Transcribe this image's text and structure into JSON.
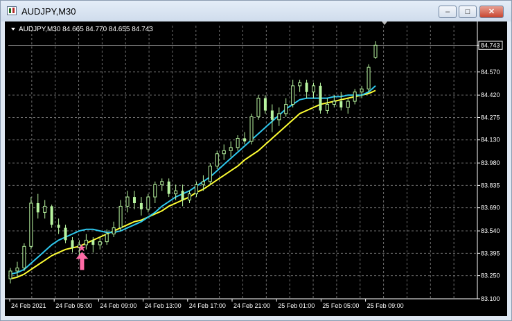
{
  "window": {
    "title": "AUDJPY,M30",
    "min_glyph": "–",
    "max_glyph": "□",
    "close_glyph": "✕"
  },
  "chart_header": {
    "text": "AUDJPY,M30  84.665 84.770 84.655 84.743"
  },
  "colors": {
    "background": "#000000",
    "grid": "#6e6e6e",
    "bull": "#b8f5a0",
    "bear": "#b8f5a0",
    "ma_fast": "#2ec8ee",
    "ma_slow": "#ffff33",
    "signal": "#ff6ba6"
  },
  "chart_data": {
    "type": "candlestick",
    "symbol": "AUDJPY",
    "timeframe": "M30",
    "current_price": "84.743",
    "ylim": [
      83.1,
      84.87
    ],
    "y_ticks": [
      "84.743",
      "84.570",
      "84.420",
      "84.275",
      "84.130",
      "83.980",
      "83.835",
      "83.690",
      "83.540",
      "83.395",
      "83.250",
      "83.100"
    ],
    "x_ticks": [
      "24 Feb 2021",
      "24 Feb 05:00",
      "24 Feb 09:00",
      "24 Feb 13:00",
      "24 Feb 17:00",
      "24 Feb 21:00",
      "25 Feb 01:00",
      "25 Feb 05:00",
      "25 Feb 09:00"
    ],
    "candles": [
      [
        83.23,
        83.3,
        83.2,
        83.28
      ],
      [
        83.28,
        83.34,
        83.24,
        83.3
      ],
      [
        83.3,
        83.46,
        83.28,
        83.44
      ],
      [
        83.44,
        83.76,
        83.42,
        83.72
      ],
      [
        83.72,
        83.78,
        83.62,
        83.66
      ],
      [
        83.66,
        83.74,
        83.62,
        83.7
      ],
      [
        83.7,
        83.71,
        83.56,
        83.58
      ],
      [
        83.58,
        83.62,
        83.52,
        83.56
      ],
      [
        83.56,
        83.58,
        83.46,
        83.48
      ],
      [
        83.48,
        83.5,
        83.4,
        83.43
      ],
      [
        83.43,
        83.48,
        83.37,
        83.45
      ],
      [
        83.45,
        83.52,
        83.42,
        83.48
      ],
      [
        83.48,
        83.5,
        83.4,
        83.45
      ],
      [
        83.45,
        83.5,
        83.42,
        83.47
      ],
      [
        83.47,
        83.55,
        83.45,
        83.52
      ],
      [
        83.52,
        83.6,
        83.5,
        83.56
      ],
      [
        83.56,
        83.74,
        83.54,
        83.7
      ],
      [
        83.7,
        83.8,
        83.66,
        83.76
      ],
      [
        83.76,
        83.8,
        83.68,
        83.72
      ],
      [
        83.72,
        83.76,
        83.64,
        83.68
      ],
      [
        83.68,
        83.78,
        83.66,
        83.76
      ],
      [
        83.76,
        83.86,
        83.72,
        83.84
      ],
      [
        83.84,
        83.88,
        83.8,
        83.86
      ],
      [
        83.86,
        83.88,
        83.76,
        83.78
      ],
      [
        83.78,
        83.84,
        83.74,
        83.8
      ],
      [
        83.8,
        83.84,
        83.7,
        83.74
      ],
      [
        83.74,
        83.8,
        83.72,
        83.78
      ],
      [
        83.78,
        83.86,
        83.76,
        83.84
      ],
      [
        83.84,
        83.9,
        83.8,
        83.86
      ],
      [
        83.86,
        83.98,
        83.84,
        83.96
      ],
      [
        83.96,
        84.06,
        83.94,
        84.04
      ],
      [
        84.04,
        84.1,
        84.0,
        84.06
      ],
      [
        84.06,
        84.12,
        84.02,
        84.08
      ],
      [
        84.08,
        84.16,
        84.06,
        84.14
      ],
      [
        84.14,
        84.18,
        84.1,
        84.12
      ],
      [
        84.12,
        84.3,
        84.1,
        84.28
      ],
      [
        84.28,
        84.42,
        84.26,
        84.4
      ],
      [
        84.4,
        84.42,
        84.3,
        84.32
      ],
      [
        84.32,
        84.36,
        84.18,
        84.26
      ],
      [
        84.26,
        84.34,
        84.22,
        84.3
      ],
      [
        84.3,
        84.4,
        84.28,
        84.36
      ],
      [
        84.36,
        84.52,
        84.34,
        84.48
      ],
      [
        84.48,
        84.52,
        84.44,
        84.5
      ],
      [
        84.5,
        84.52,
        84.4,
        84.44
      ],
      [
        84.44,
        84.5,
        84.4,
        84.48
      ],
      [
        84.48,
        84.5,
        84.3,
        84.32
      ],
      [
        84.32,
        84.4,
        84.3,
        84.36
      ],
      [
        84.36,
        84.42,
        84.34,
        84.38
      ],
      [
        84.38,
        84.44,
        84.32,
        84.34
      ],
      [
        84.34,
        84.4,
        84.3,
        84.38
      ],
      [
        84.38,
        84.46,
        84.36,
        84.44
      ],
      [
        84.44,
        84.48,
        84.4,
        84.46
      ],
      [
        84.46,
        84.62,
        84.44,
        84.6
      ],
      [
        84.665,
        84.77,
        84.655,
        84.743
      ]
    ],
    "ma_fast": [
      83.26,
      83.27,
      83.29,
      83.33,
      83.37,
      83.41,
      83.45,
      83.48,
      83.5,
      83.52,
      83.54,
      83.55,
      83.55,
      83.54,
      83.53,
      83.53,
      83.54,
      83.56,
      83.58,
      83.6,
      83.63,
      83.66,
      83.7,
      83.73,
      83.76,
      83.78,
      83.8,
      83.83,
      83.86,
      83.89,
      83.93,
      83.97,
      84.01,
      84.05,
      84.09,
      84.13,
      84.17,
      84.21,
      84.25,
      84.29,
      84.33,
      84.36,
      84.39,
      84.4,
      84.4,
      84.4,
      84.4,
      84.41,
      84.41,
      84.42,
      84.42,
      84.42,
      84.44,
      84.48
    ],
    "ma_slow": [
      83.23,
      83.24,
      83.26,
      83.29,
      83.32,
      83.35,
      83.38,
      83.4,
      83.42,
      83.43,
      83.44,
      83.46,
      83.48,
      83.5,
      83.52,
      83.54,
      83.56,
      83.58,
      83.6,
      83.61,
      83.63,
      83.65,
      83.67,
      83.7,
      83.72,
      83.74,
      83.76,
      83.79,
      83.81,
      83.84,
      83.87,
      83.9,
      83.93,
      83.96,
      84.0,
      84.03,
      84.06,
      84.1,
      84.14,
      84.18,
      84.22,
      84.26,
      84.3,
      84.32,
      84.34,
      84.36,
      84.37,
      84.38,
      84.39,
      84.4,
      84.41,
      84.42,
      84.43,
      84.45
    ],
    "signal": {
      "index": 10,
      "marker": "★",
      "arrow": "up"
    }
  }
}
